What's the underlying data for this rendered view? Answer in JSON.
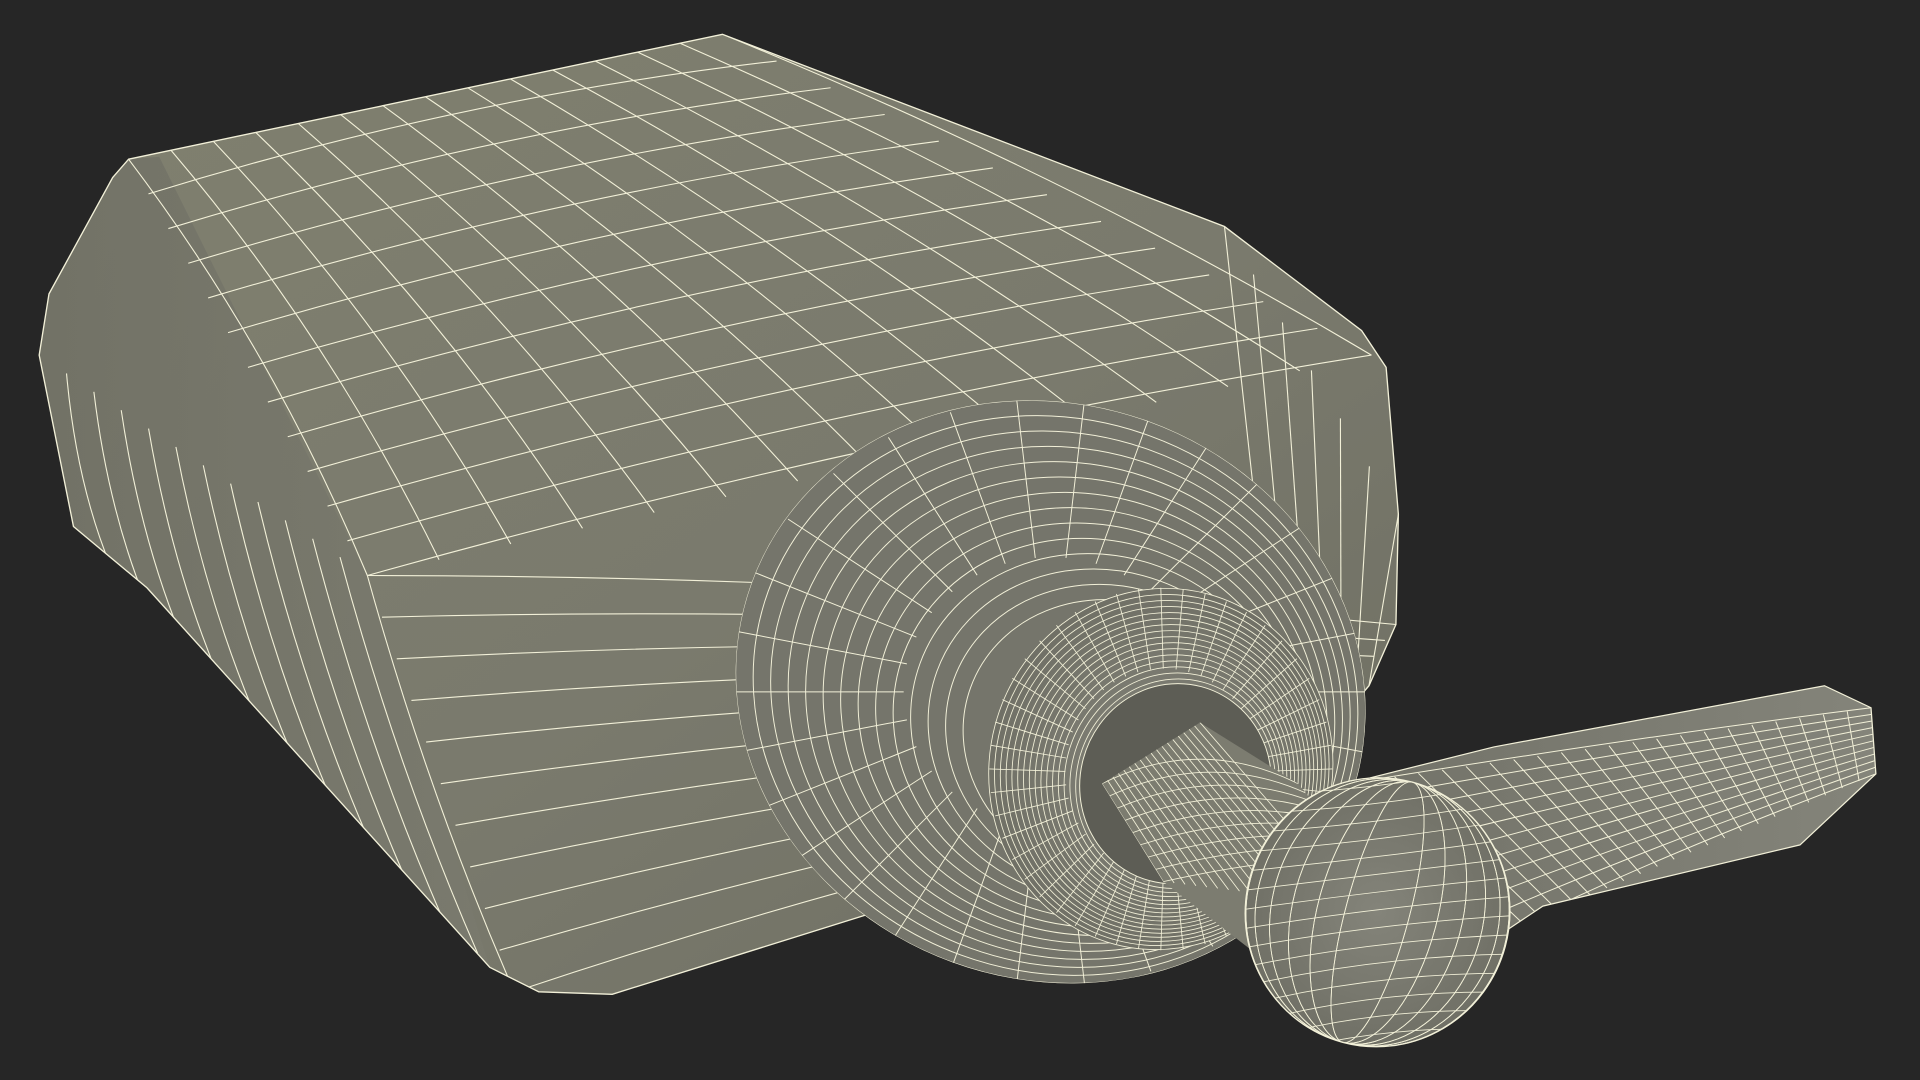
{
  "scene": {
    "subject": "pump-bottle-wireframe-render",
    "background_color": "#262626",
    "surface_color": "#7a7a6e",
    "surface_shadow_color": "#5f5f56",
    "surface_highlight_color": "#8a8a7e",
    "wire_color": "#f2f0d8"
  }
}
